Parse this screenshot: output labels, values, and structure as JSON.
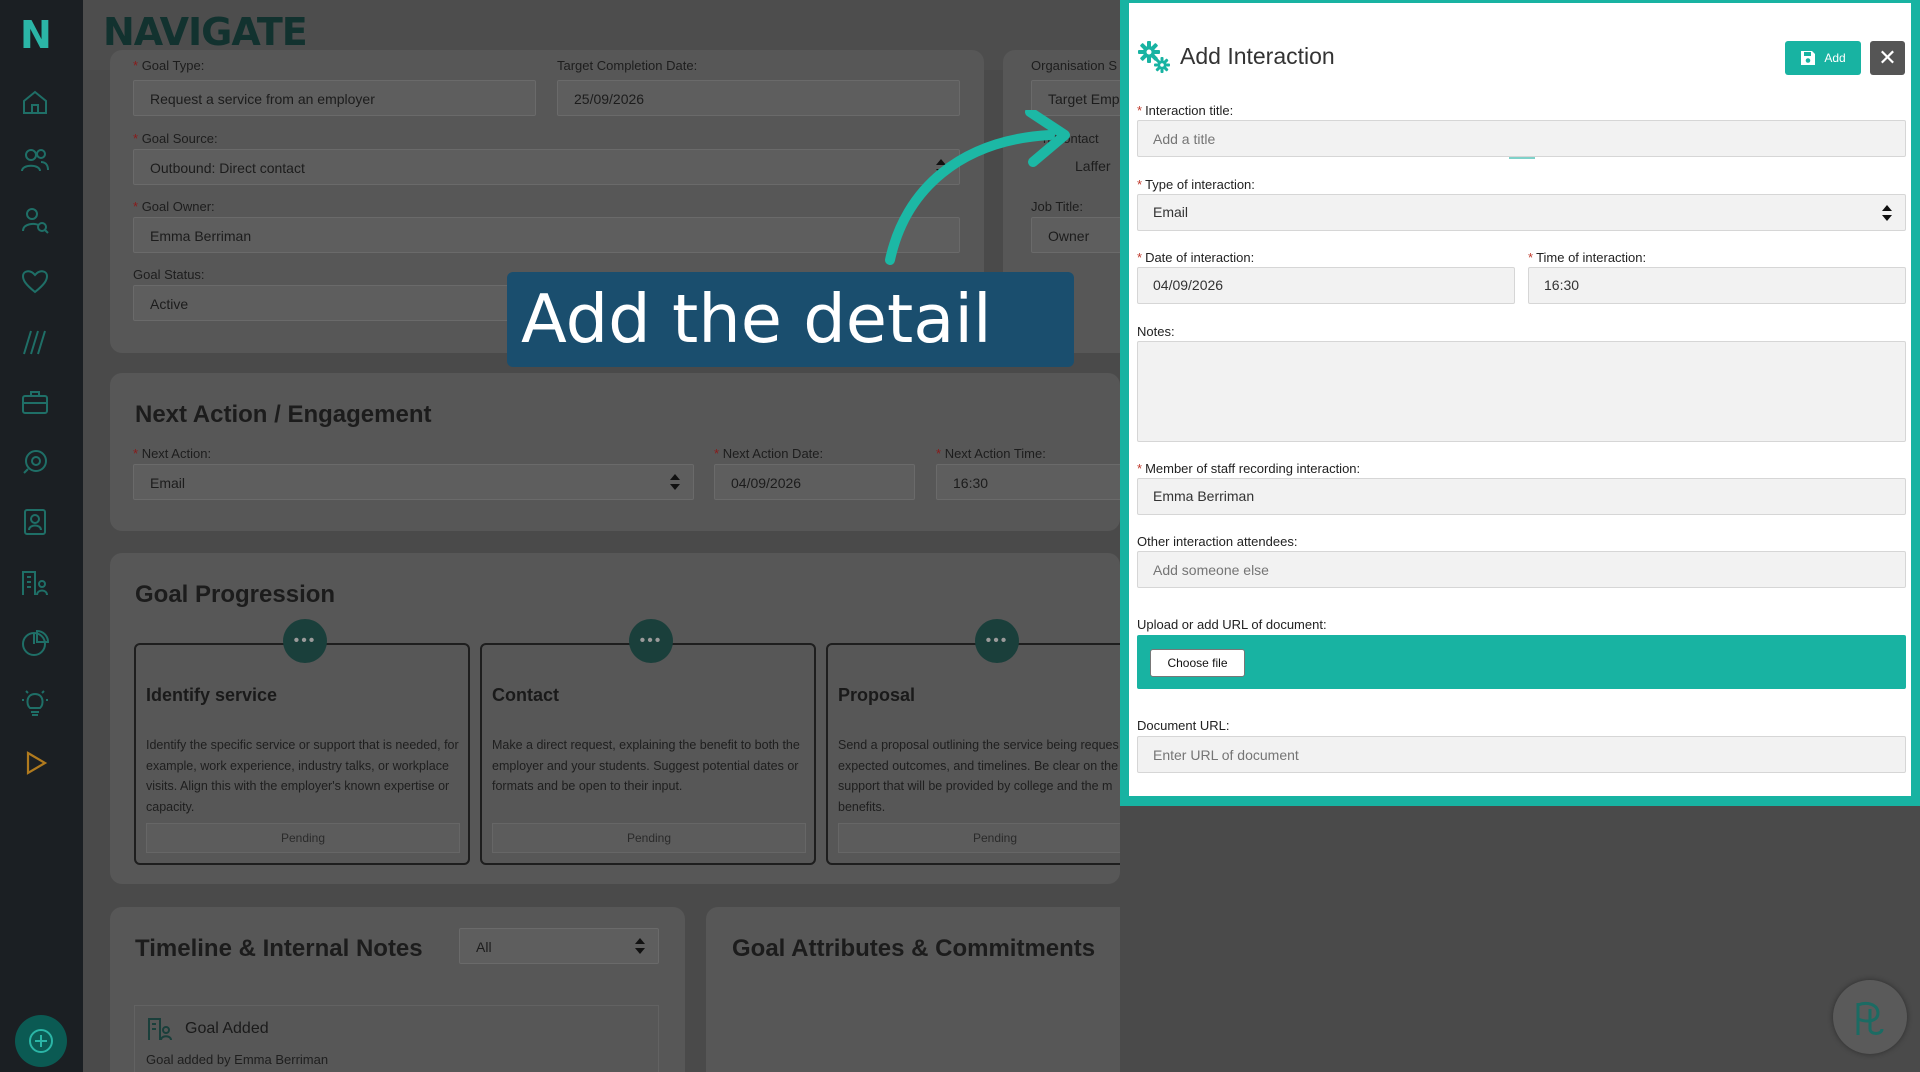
{
  "app": {
    "brand": "NAVIGATE",
    "logo_letter": "N"
  },
  "sidebar": {
    "icons": [
      "home-icon",
      "people-icon",
      "user-search-icon",
      "heart-icon",
      "slashes-icon",
      "briefcase-icon",
      "rocket-icon",
      "contact-card-icon",
      "building-people-icon",
      "pie-chart-icon",
      "lightbulb-icon",
      "play-icon"
    ],
    "add_icon": "plus-circle-icon"
  },
  "goal_details": {
    "goal_type_label": "Goal Type:",
    "goal_type_value": "Request a service from an employer",
    "target_completion_label": "Target Completion Date:",
    "target_completion_value": "25/09/2026",
    "goal_source_label": "Goal Source:",
    "goal_source_value": "Outbound: Direct contact",
    "goal_owner_label": "Goal Owner:",
    "goal_owner_value": "Emma Berriman",
    "goal_status_label": "Goal Status:",
    "goal_status_value": "Active",
    "org_label": "Organisation S",
    "org_value": "Target Empl",
    "contact_label": "n Contact",
    "contact_value": "Laffer",
    "job_title_label": "Job Title:",
    "job_title_value": "Owner"
  },
  "next_action": {
    "title": "Next Action / Engagement",
    "action_label": "Next Action:",
    "action_value": "Email",
    "date_label": "Next Action Date:",
    "date_value": "04/09/2026",
    "time_label": "Next Action Time:",
    "time_value": "16:30"
  },
  "goal_progression": {
    "title": "Goal Progression",
    "steps": [
      {
        "title": "Identify service",
        "text": "Identify the specific service or support that is needed, for example, work experience, industry talks, or workplace visits. Align this with the employer's known expertise or capacity.",
        "status": "Pending"
      },
      {
        "title": "Contact",
        "text": "Make a direct request, explaining the benefit to both the employer and your students. Suggest potential dates or formats and be open to their input.",
        "status": "Pending"
      },
      {
        "title": "Proposal",
        "text": "Send a proposal outlining the service being reques expected outcomes, and timelines. Be clear on the support that will be provided by college and the m benefits.",
        "status": "Pending"
      }
    ]
  },
  "timeline": {
    "title": "Timeline & Internal Notes",
    "filter_value": "All",
    "entry_title": "Goal Added",
    "entry_text": "Goal added by Emma Berriman"
  },
  "attributes": {
    "title": "Goal Attributes & Commitments"
  },
  "tooltip": {
    "text": "Add the detail"
  },
  "modal": {
    "title": "Add Interaction",
    "add_label": "Add",
    "close_label": "✕",
    "interaction_title_label": "Interaction title:",
    "interaction_title_placeholder": "Add a title",
    "type_label": "Type of interaction:",
    "type_value": "Email",
    "date_label": "Date of interaction:",
    "date_value": "04/09/2026",
    "time_label": "Time of interaction:",
    "time_value": "16:30",
    "notes_label": "Notes:",
    "notes_value": "",
    "staff_label": "Member of staff recording interaction:",
    "staff_value": "Emma Berriman",
    "attendees_label": "Other interaction attendees:",
    "attendees_placeholder": "Add someone else",
    "upload_label": "Upload or add URL of document:",
    "choose_file_label": "Choose file",
    "doc_url_label": "Document URL:",
    "doc_url_placeholder": "Enter URL of document"
  },
  "colors": {
    "accent": "#18b3a2",
    "tooltip_bg": "#1a4e6e",
    "sidebar_bg": "#1b1f23"
  }
}
